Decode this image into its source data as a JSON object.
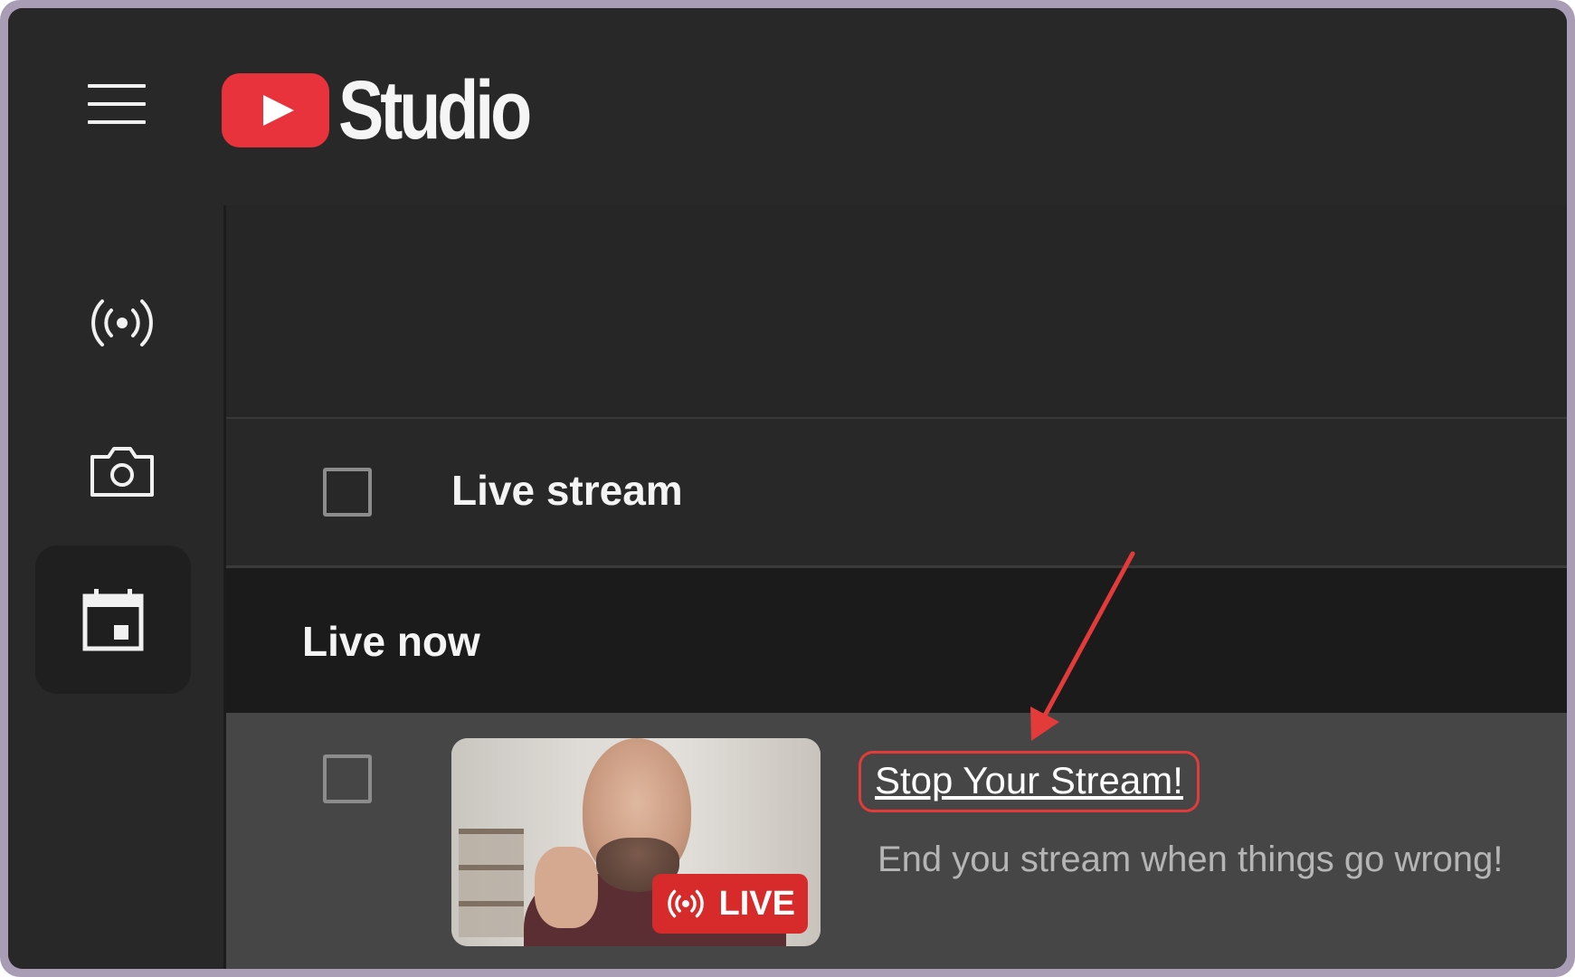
{
  "header": {
    "logo_text": "Studio",
    "menu_icon": "hamburger-menu-icon",
    "logo_icon": "youtube-play-logo-icon"
  },
  "sidebar": {
    "items": [
      {
        "icon": "live-broadcast-icon",
        "active": false
      },
      {
        "icon": "camera-icon",
        "active": false
      },
      {
        "icon": "calendar-schedule-icon",
        "active": true
      }
    ]
  },
  "main": {
    "live_stream_row": {
      "title": "Live stream"
    },
    "live_now_section": {
      "title": "Live now"
    },
    "stream_item": {
      "badge_label": "LIVE",
      "badge_icon": "live-broadcast-icon",
      "link_text": "Stop Your Stream!",
      "description": "End you stream when things go wrong!"
    }
  },
  "colors": {
    "accent_red": "#e8323c",
    "annotation_red": "#e33a3a",
    "frame": "#a99db5",
    "background": "#282828"
  }
}
